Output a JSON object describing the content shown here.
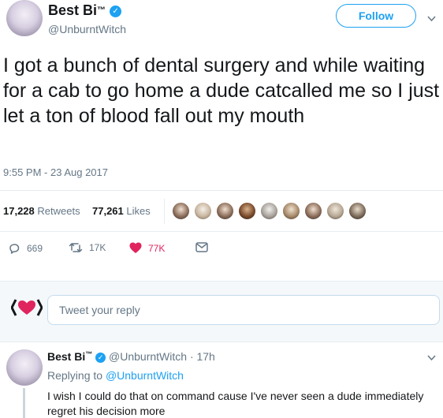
{
  "tweet": {
    "author": {
      "display_name": "Best Bi",
      "trademark": "™",
      "handle": "@UnburntWitch"
    },
    "follow_label": "Follow",
    "text": "I got a bunch of dental surgery and while waiting for a cab to go home a dude catcalled me so I just let a ton of blood fall out my mouth",
    "timestamp": "9:55 PM - 23 Aug 2017",
    "stats": {
      "retweets_count": "17,228",
      "retweets_label": "Retweets",
      "likes_count": "77,261",
      "likes_label": "Likes"
    },
    "actions": {
      "replies": "669",
      "retweets": "17K",
      "likes": "77K"
    }
  },
  "reply_box": {
    "placeholder": "Tweet your reply"
  },
  "reply": {
    "author_name": "Best Bi",
    "trademark": "™",
    "handle": "@UnburntWitch",
    "time": "· 17h",
    "replying_prefix": "Replying to",
    "replying_to": "@UnburntWitch",
    "text_line1": "I wish I could do that on command cause I've never seen a dude immediately",
    "text_line2": "regret his decision more"
  },
  "colors": {
    "accent": "#1da1f2",
    "like": "#e0245e",
    "text": "#14171a",
    "muted": "#657786"
  }
}
